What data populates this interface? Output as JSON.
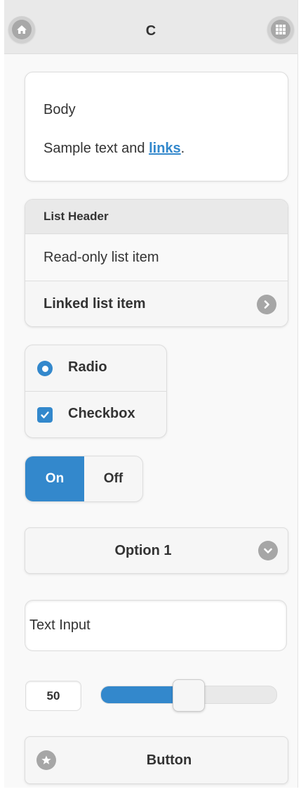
{
  "header": {
    "title": "C",
    "left_icon": "home-icon",
    "right_icon": "grid-icon"
  },
  "body_card": {
    "heading": "Body",
    "text_before_link": "Sample text and ",
    "link_text": "links",
    "text_after_link": "."
  },
  "list": {
    "header": "List Header",
    "readonly_item": "Read-only list item",
    "linked_item": "Linked list item",
    "linked_icon": "chevron-right-icon"
  },
  "controls": {
    "radio_label": "Radio",
    "radio_checked": true,
    "checkbox_label": "Checkbox",
    "checkbox_checked": true
  },
  "flip_switch": {
    "on_label": "On",
    "off_label": "Off",
    "state": "On"
  },
  "select": {
    "selected": "Option 1",
    "icon": "chevron-down-icon"
  },
  "text_input": {
    "placeholder": "Text Input",
    "value": ""
  },
  "slider": {
    "value": "50",
    "min": 0,
    "max": 100
  },
  "button": {
    "label": "Button",
    "icon": "star-icon"
  },
  "colors": {
    "accent": "#3388cc",
    "icon_gray": "#a6a6a6",
    "header_bg": "#e9e9e9",
    "page_bg": "#f9f9f9"
  }
}
